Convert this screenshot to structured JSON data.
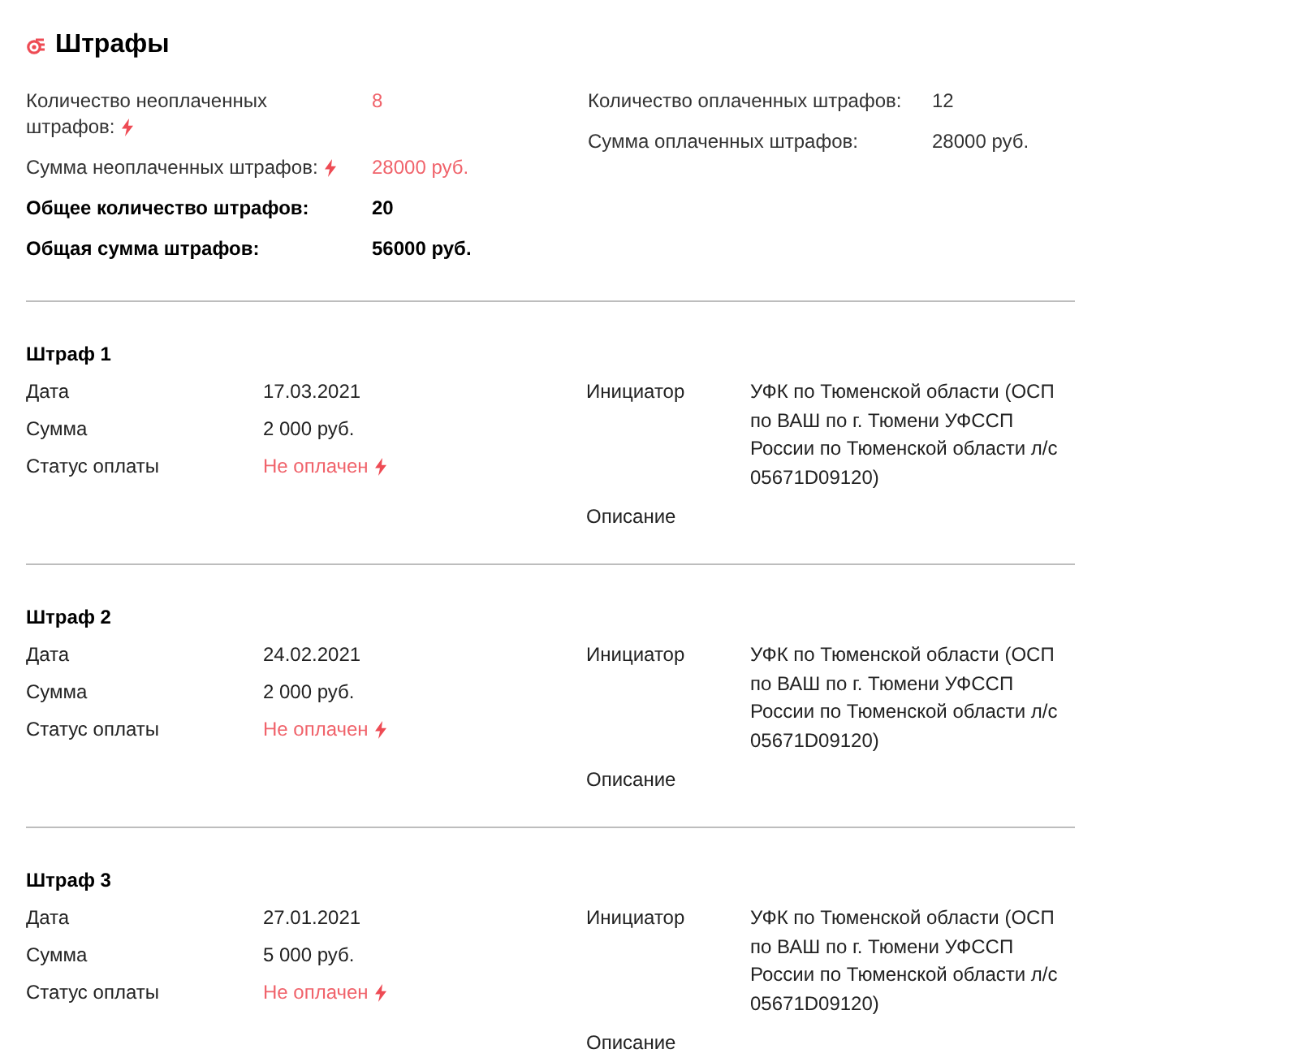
{
  "title": "Штрафы",
  "summary_left": [
    {
      "label": "Количество неоплаченных штрафов:",
      "value": "8",
      "kind": "alert"
    },
    {
      "label": "Сумма неоплаченных штрафов:",
      "value": "28000 руб.",
      "kind": "alert"
    },
    {
      "label": "Общее количество штрафов:",
      "value": "20",
      "kind": "total"
    },
    {
      "label": "Общая сумма штрафов:",
      "value": "56000 руб.",
      "kind": "total"
    }
  ],
  "summary_right": [
    {
      "label": "Количество оплаченных штрафов:",
      "value": "12",
      "kind": "plain"
    },
    {
      "label": "Сумма оплаченных штрафов:",
      "value": "28000 руб.",
      "kind": "plain"
    }
  ],
  "fines": [
    {
      "title": "Штраф 1",
      "date_label": "Дата",
      "date": "17.03.2021",
      "sum_label": "Сумма",
      "sum": "2 000 руб.",
      "status_label": "Статус оплаты",
      "status": "Не оплачен",
      "paid": false,
      "initiator_label": "Инициатор",
      "initiator": "УФК по Тюменской области (ОСП по ВАШ по г. Тюмени УФССП России по Тюменской области л/с 05671D09120)",
      "description_label": "Описание"
    },
    {
      "title": "Штраф 2",
      "date_label": "Дата",
      "date": "24.02.2021",
      "sum_label": "Сумма",
      "sum": "2 000 руб.",
      "status_label": "Статус оплаты",
      "status": "Не оплачен",
      "paid": false,
      "initiator_label": "Инициатор",
      "initiator": "УФК по Тюменской области (ОСП по ВАШ по г. Тюмени УФССП России по Тюменской области л/с 05671D09120)",
      "description_label": "Описание"
    },
    {
      "title": "Штраф 3",
      "date_label": "Дата",
      "date": "27.01.2021",
      "sum_label": "Сумма",
      "sum": "5 000 руб.",
      "status_label": "Статус оплаты",
      "status": "Не оплачен",
      "paid": false,
      "initiator_label": "Инициатор",
      "initiator": "УФК по Тюменской области (ОСП по ВАШ по г. Тюмени УФССП России по Тюменской области л/с 05671D09120)",
      "description_label": "Описание"
    }
  ]
}
